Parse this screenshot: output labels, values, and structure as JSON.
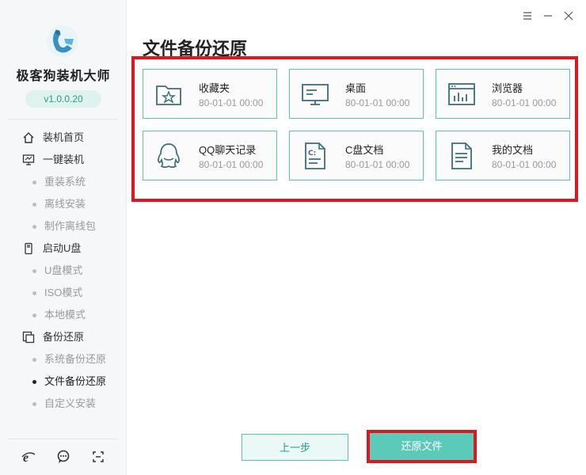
{
  "app": {
    "name": "极客狗装机大师",
    "version": "v1.0.0.20"
  },
  "sidebar": {
    "items": [
      {
        "label": "装机首页",
        "type": "section",
        "icon": "home-icon"
      },
      {
        "label": "一键装机",
        "type": "section",
        "icon": "monitor-icon"
      },
      {
        "label": "重装系统",
        "type": "sub"
      },
      {
        "label": "离线安装",
        "type": "sub"
      },
      {
        "label": "制作离线包",
        "type": "sub"
      },
      {
        "label": "启动U盘",
        "type": "section",
        "icon": "usb-icon"
      },
      {
        "label": "U盘模式",
        "type": "sub"
      },
      {
        "label": "ISO模式",
        "type": "sub"
      },
      {
        "label": "本地模式",
        "type": "sub"
      },
      {
        "label": "备份还原",
        "type": "section",
        "icon": "backup-icon"
      },
      {
        "label": "系统备份还原",
        "type": "sub"
      },
      {
        "label": "文件备份还原",
        "type": "sub",
        "active": true
      },
      {
        "label": "自定义安装",
        "type": "sub"
      }
    ],
    "footer_icons": [
      "ie-browser-icon",
      "chat-icon",
      "fullscreen-icon"
    ]
  },
  "window_controls": [
    "menu-icon",
    "minimize-icon",
    "close-icon"
  ],
  "main": {
    "title": "文件备份还原",
    "cards": [
      {
        "name": "收藏夹",
        "date": "80-01-01 00:00",
        "icon": "favorites-folder-icon"
      },
      {
        "name": "桌面",
        "date": "80-01-01 00:00",
        "icon": "desktop-icon"
      },
      {
        "name": "浏览器",
        "date": "80-01-01 00:00",
        "icon": "browser-icon"
      },
      {
        "name": "QQ聊天记录",
        "date": "80-01-01 00:00",
        "icon": "qq-icon"
      },
      {
        "name": "C盘文档",
        "date": "80-01-01 00:00",
        "icon": "c-drive-document-icon"
      },
      {
        "name": "我的文档",
        "date": "80-01-01 00:00",
        "icon": "my-document-icon"
      }
    ],
    "prev_button": "上一步",
    "restore_button": "还原文件"
  },
  "colors": {
    "accent": "#5ccab8",
    "highlight": "#e0161e",
    "card_border": "#5cc3b1"
  }
}
